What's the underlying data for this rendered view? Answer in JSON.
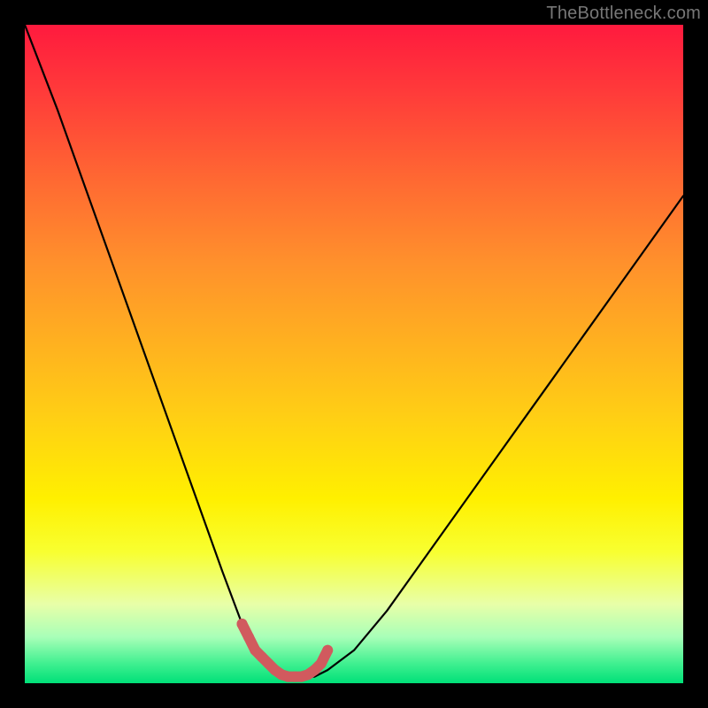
{
  "watermark": "TheBottleneck.com",
  "colors": {
    "curve": "#000000",
    "marker": "#d15a5e",
    "frame": "#000000"
  },
  "chart_data": {
    "type": "line",
    "title": "",
    "xlabel": "",
    "ylabel": "",
    "xlim": [
      0,
      100
    ],
    "ylim": [
      0,
      100
    ],
    "grid": false,
    "legend": false,
    "series": [
      {
        "name": "bottleneck-curve",
        "x": [
          0,
          5,
          10,
          15,
          20,
          25,
          30,
          33,
          36,
          38,
          40,
          42,
          44,
          46,
          50,
          55,
          60,
          65,
          70,
          75,
          80,
          85,
          90,
          95,
          100
        ],
        "y": [
          100,
          87,
          73,
          59,
          45,
          31,
          17,
          9,
          4,
          2,
          1,
          1,
          1,
          2,
          5,
          11,
          18,
          25,
          32,
          39,
          46,
          53,
          60,
          67,
          74
        ]
      }
    ],
    "markers": {
      "name": "valley-highlight",
      "x": [
        33,
        34,
        35,
        36,
        37,
        38,
        39,
        40,
        41,
        42,
        43,
        44,
        45,
        46
      ],
      "y": [
        9,
        7,
        5,
        4,
        3,
        2,
        1.3,
        1,
        1,
        1,
        1.3,
        2,
        3,
        5
      ]
    },
    "background_gradient": {
      "direction": "top-red-to-bottom-green",
      "stops": [
        {
          "pos": 0.0,
          "color": "#ff1a3e"
        },
        {
          "pos": 0.36,
          "color": "#ff902c"
        },
        {
          "pos": 0.72,
          "color": "#fff000"
        },
        {
          "pos": 0.93,
          "color": "#a8ffb8"
        },
        {
          "pos": 1.0,
          "color": "#00e078"
        }
      ]
    }
  }
}
